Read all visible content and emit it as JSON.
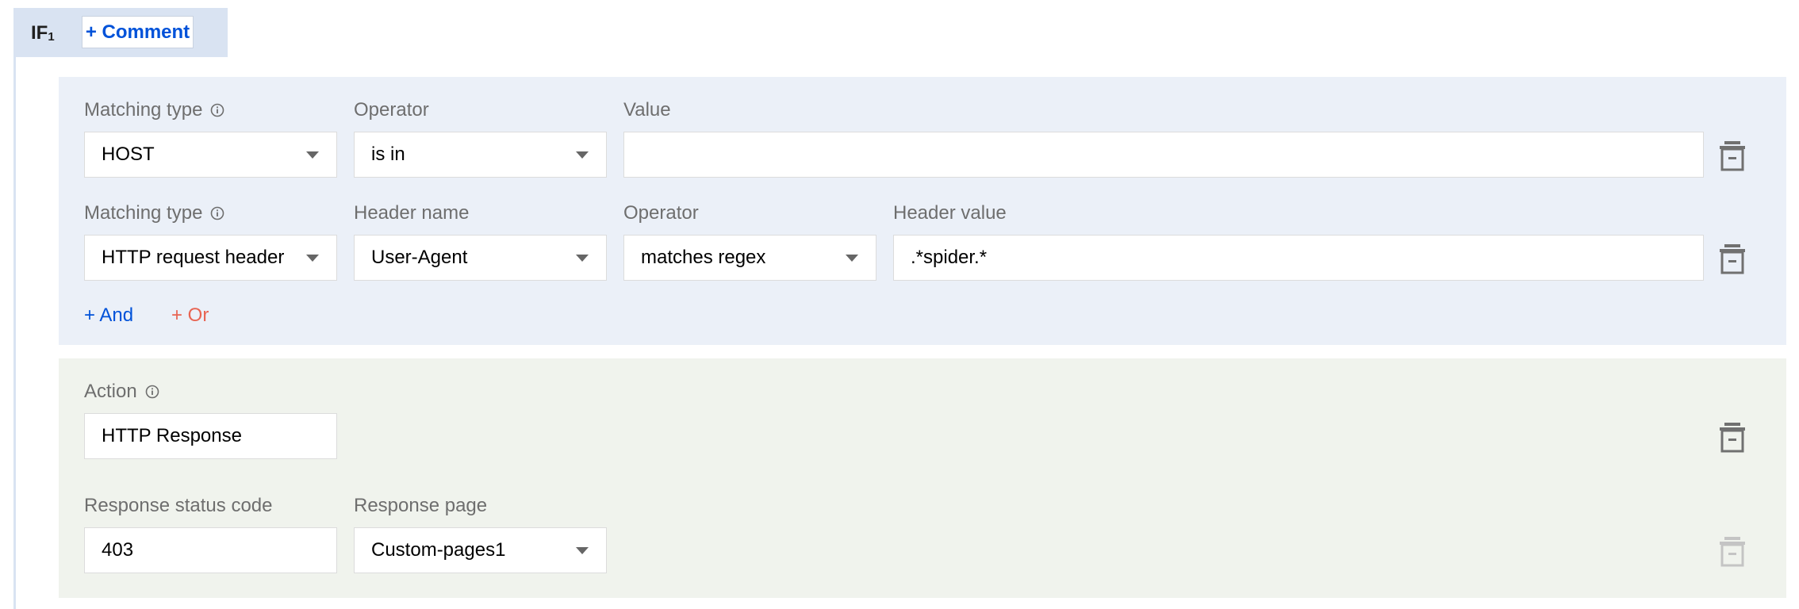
{
  "rule": {
    "if_label": "IF",
    "if_index": "1",
    "comment_button": "+ Comment"
  },
  "conditions": {
    "row1": {
      "matching_type_label": "Matching type",
      "matching_type_value": "HOST",
      "operator_label": "Operator",
      "operator_value": "is in",
      "value_label": "Value",
      "value_value": ""
    },
    "row2": {
      "matching_type_label": "Matching type",
      "matching_type_value": "HTTP request header",
      "header_name_label": "Header name",
      "header_name_value": "User-Agent",
      "operator_label": "Operator",
      "operator_value": "matches regex",
      "header_value_label": "Header value",
      "header_value_value": ".*spider.*"
    },
    "and_link": "+ And",
    "or_link": "+ Or"
  },
  "action": {
    "action_label": "Action",
    "action_value": "HTTP Response",
    "status_code_label": "Response status code",
    "status_code_value": "403",
    "response_page_label": "Response page",
    "response_page_value": "Custom-pages1"
  },
  "colors": {
    "accent_blue": "#0052d9",
    "or_red": "#e86452",
    "condition_bg": "#ebf0f8",
    "action_bg": "#f0f3ed"
  },
  "icons": {
    "info": "info-icon",
    "delete": "trash-icon",
    "dropdown": "chevron-down-icon"
  }
}
